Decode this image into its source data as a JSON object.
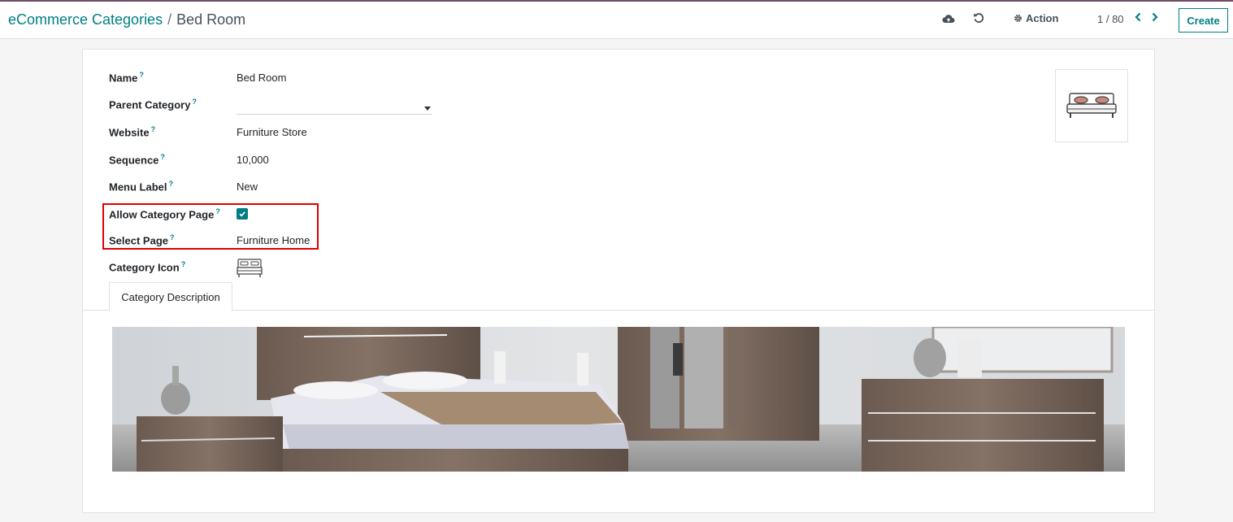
{
  "breadcrumb": {
    "parent": "eCommerce Categories",
    "separator": "/",
    "current": "Bed Room"
  },
  "toolbar": {
    "action_label": "Action",
    "pager": "1 / 80",
    "create_label": "Create"
  },
  "form": {
    "name": {
      "label": "Name",
      "help": "?",
      "value": "Bed Room"
    },
    "parent_category": {
      "label": "Parent Category",
      "help": "?",
      "value": ""
    },
    "website": {
      "label": "Website",
      "help": "?",
      "value": "Furniture Store"
    },
    "sequence": {
      "label": "Sequence",
      "help": "?",
      "value": "10,000"
    },
    "menu_label": {
      "label": "Menu Label",
      "help": "?",
      "value": "New"
    },
    "allow_category_page": {
      "label": "Allow Category Page",
      "help": "?",
      "checked": true
    },
    "select_page": {
      "label": "Select Page",
      "help": "?",
      "value": "Furniture Home"
    },
    "category_icon": {
      "label": "Category Icon",
      "help": "?",
      "icon": "bed-icon"
    }
  },
  "tabs": [
    {
      "label": "Category Description",
      "active": true
    }
  ],
  "colors": {
    "accent": "#017e84",
    "highlight": "#e00000",
    "brand_bar": "#714b67"
  }
}
